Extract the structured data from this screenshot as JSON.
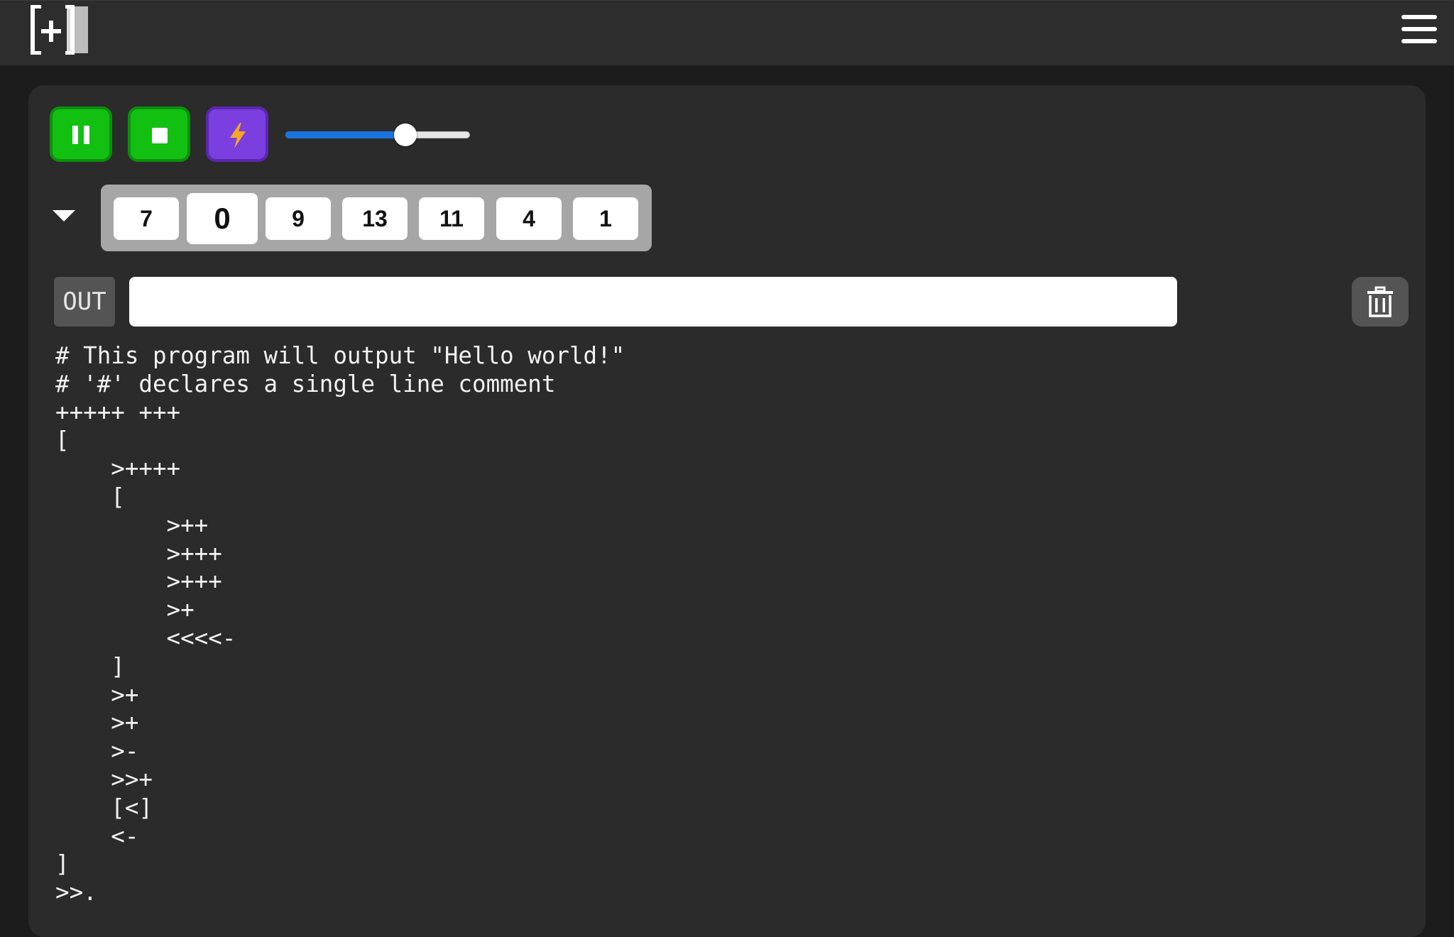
{
  "header": {
    "logo_icon": "bracket-plus-logo-icon",
    "menu_icon": "hamburger-menu-icon"
  },
  "controls": {
    "pause_icon": "pause-icon",
    "stop_icon": "stop-icon",
    "flash_icon": "lightning-bolt-icon",
    "speed_fraction": 0.65,
    "colors": {
      "run": "#12c012",
      "flash": "#7b3fe0",
      "bolt": "#f5a623",
      "slider_fill": "#1a74e0"
    }
  },
  "tape": {
    "toggle_icon": "caret-down-icon",
    "cells": [
      "7",
      "0",
      "9",
      "13",
      "11",
      "4",
      "1"
    ],
    "active_index": 1
  },
  "output": {
    "label": "OUT",
    "value": "",
    "clear_icon": "trash-icon"
  },
  "editor": {
    "code": "# This program will output \"Hello world!\"\n# '#' declares a single line comment\n+++++ +++\n[\n    >++++\n    [\n        >++\n        >+++\n        >+++\n        >+\n        <<<<-\n    ]\n    >+\n    >+\n    >-\n    >>+\n    [<]\n    <-\n]\n>>."
  }
}
